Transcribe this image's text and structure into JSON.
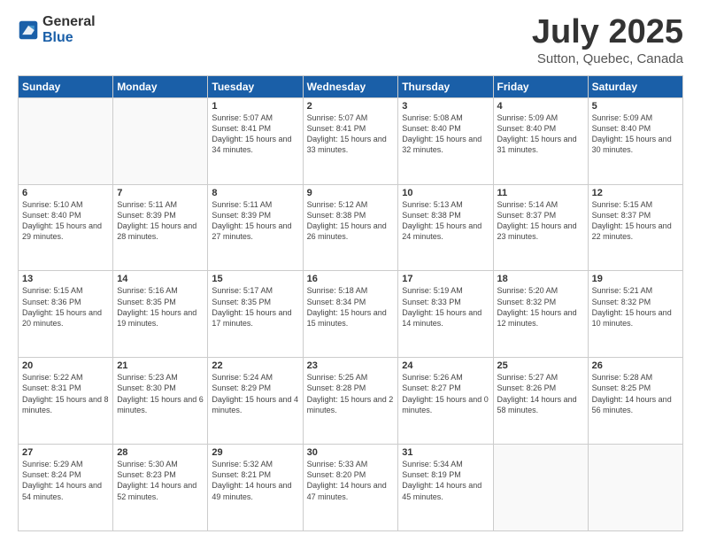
{
  "logo": {
    "general": "General",
    "blue": "Blue"
  },
  "header": {
    "month": "July 2025",
    "location": "Sutton, Quebec, Canada"
  },
  "weekdays": [
    "Sunday",
    "Monday",
    "Tuesday",
    "Wednesday",
    "Thursday",
    "Friday",
    "Saturday"
  ],
  "weeks": [
    [
      {
        "day": "",
        "info": ""
      },
      {
        "day": "",
        "info": ""
      },
      {
        "day": "1",
        "info": "Sunrise: 5:07 AM\nSunset: 8:41 PM\nDaylight: 15 hours and 34 minutes."
      },
      {
        "day": "2",
        "info": "Sunrise: 5:07 AM\nSunset: 8:41 PM\nDaylight: 15 hours and 33 minutes."
      },
      {
        "day": "3",
        "info": "Sunrise: 5:08 AM\nSunset: 8:40 PM\nDaylight: 15 hours and 32 minutes."
      },
      {
        "day": "4",
        "info": "Sunrise: 5:09 AM\nSunset: 8:40 PM\nDaylight: 15 hours and 31 minutes."
      },
      {
        "day": "5",
        "info": "Sunrise: 5:09 AM\nSunset: 8:40 PM\nDaylight: 15 hours and 30 minutes."
      }
    ],
    [
      {
        "day": "6",
        "info": "Sunrise: 5:10 AM\nSunset: 8:40 PM\nDaylight: 15 hours and 29 minutes."
      },
      {
        "day": "7",
        "info": "Sunrise: 5:11 AM\nSunset: 8:39 PM\nDaylight: 15 hours and 28 minutes."
      },
      {
        "day": "8",
        "info": "Sunrise: 5:11 AM\nSunset: 8:39 PM\nDaylight: 15 hours and 27 minutes."
      },
      {
        "day": "9",
        "info": "Sunrise: 5:12 AM\nSunset: 8:38 PM\nDaylight: 15 hours and 26 minutes."
      },
      {
        "day": "10",
        "info": "Sunrise: 5:13 AM\nSunset: 8:38 PM\nDaylight: 15 hours and 24 minutes."
      },
      {
        "day": "11",
        "info": "Sunrise: 5:14 AM\nSunset: 8:37 PM\nDaylight: 15 hours and 23 minutes."
      },
      {
        "day": "12",
        "info": "Sunrise: 5:15 AM\nSunset: 8:37 PM\nDaylight: 15 hours and 22 minutes."
      }
    ],
    [
      {
        "day": "13",
        "info": "Sunrise: 5:15 AM\nSunset: 8:36 PM\nDaylight: 15 hours and 20 minutes."
      },
      {
        "day": "14",
        "info": "Sunrise: 5:16 AM\nSunset: 8:35 PM\nDaylight: 15 hours and 19 minutes."
      },
      {
        "day": "15",
        "info": "Sunrise: 5:17 AM\nSunset: 8:35 PM\nDaylight: 15 hours and 17 minutes."
      },
      {
        "day": "16",
        "info": "Sunrise: 5:18 AM\nSunset: 8:34 PM\nDaylight: 15 hours and 15 minutes."
      },
      {
        "day": "17",
        "info": "Sunrise: 5:19 AM\nSunset: 8:33 PM\nDaylight: 15 hours and 14 minutes."
      },
      {
        "day": "18",
        "info": "Sunrise: 5:20 AM\nSunset: 8:32 PM\nDaylight: 15 hours and 12 minutes."
      },
      {
        "day": "19",
        "info": "Sunrise: 5:21 AM\nSunset: 8:32 PM\nDaylight: 15 hours and 10 minutes."
      }
    ],
    [
      {
        "day": "20",
        "info": "Sunrise: 5:22 AM\nSunset: 8:31 PM\nDaylight: 15 hours and 8 minutes."
      },
      {
        "day": "21",
        "info": "Sunrise: 5:23 AM\nSunset: 8:30 PM\nDaylight: 15 hours and 6 minutes."
      },
      {
        "day": "22",
        "info": "Sunrise: 5:24 AM\nSunset: 8:29 PM\nDaylight: 15 hours and 4 minutes."
      },
      {
        "day": "23",
        "info": "Sunrise: 5:25 AM\nSunset: 8:28 PM\nDaylight: 15 hours and 2 minutes."
      },
      {
        "day": "24",
        "info": "Sunrise: 5:26 AM\nSunset: 8:27 PM\nDaylight: 15 hours and 0 minutes."
      },
      {
        "day": "25",
        "info": "Sunrise: 5:27 AM\nSunset: 8:26 PM\nDaylight: 14 hours and 58 minutes."
      },
      {
        "day": "26",
        "info": "Sunrise: 5:28 AM\nSunset: 8:25 PM\nDaylight: 14 hours and 56 minutes."
      }
    ],
    [
      {
        "day": "27",
        "info": "Sunrise: 5:29 AM\nSunset: 8:24 PM\nDaylight: 14 hours and 54 minutes."
      },
      {
        "day": "28",
        "info": "Sunrise: 5:30 AM\nSunset: 8:23 PM\nDaylight: 14 hours and 52 minutes."
      },
      {
        "day": "29",
        "info": "Sunrise: 5:32 AM\nSunset: 8:21 PM\nDaylight: 14 hours and 49 minutes."
      },
      {
        "day": "30",
        "info": "Sunrise: 5:33 AM\nSunset: 8:20 PM\nDaylight: 14 hours and 47 minutes."
      },
      {
        "day": "31",
        "info": "Sunrise: 5:34 AM\nSunset: 8:19 PM\nDaylight: 14 hours and 45 minutes."
      },
      {
        "day": "",
        "info": ""
      },
      {
        "day": "",
        "info": ""
      }
    ]
  ]
}
